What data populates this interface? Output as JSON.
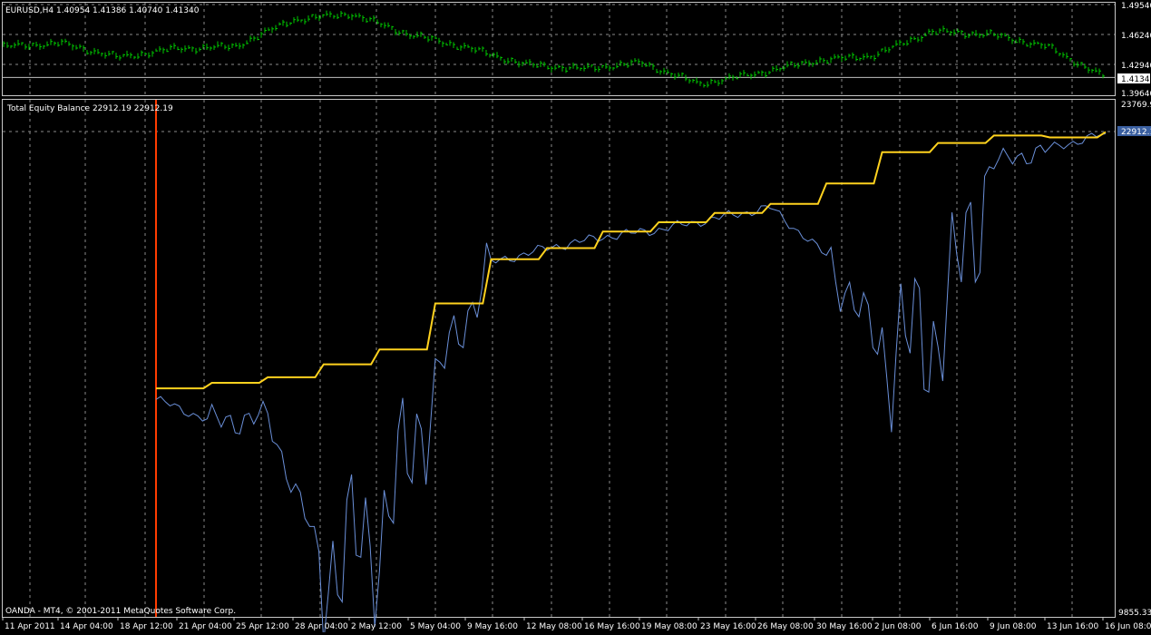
{
  "price_panel": {
    "header": "EURUSD,H4  1.40954 1.41386 1.40740 1.41340",
    "current_price": "1.41340",
    "axis_labels": [
      "1.49540",
      "1.46240",
      "1.42940",
      "1.39640"
    ],
    "colors": {
      "bars": "#00c800",
      "current_line": "#c0c0c0"
    },
    "chart_data": {
      "type": "line",
      "title": "EURUSD,H4",
      "ylim": [
        1.3964,
        1.4954
      ],
      "x": [
        "11 Apr 2011",
        "14 Apr 04:00",
        "18 Apr 12:00",
        "21 Apr 04:00",
        "25 Apr 12:00",
        "28 Apr 04:00",
        "2 May 12:00",
        "5 May 04:00",
        "9 May 16:00",
        "12 May 08:00",
        "16 May 16:00",
        "19 May 08:00",
        "23 May 16:00",
        "26 May 08:00",
        "30 May 16:00",
        "2 Jun 08:00",
        "6 Jun 16:00",
        "9 Jun 08:00",
        "13 Jun 16:00",
        "16 Jun 08:00"
      ],
      "series": [
        {
          "values": [
            1.448,
            1.452,
            1.436,
            1.446,
            1.448,
            1.478,
            1.485,
            1.462,
            1.447,
            1.428,
            1.423,
            1.43,
            1.406,
            1.418,
            1.432,
            1.438,
            1.465,
            1.462,
            1.448,
            1.413
          ]
        }
      ]
    }
  },
  "equity_panel": {
    "header": "Total Equity Balance 22912.19 22912.19",
    "axis_top": "23769.9",
    "axis_bottom": "9855.33",
    "current_value": "22912.1",
    "colors": {
      "balance": "#ffd21e",
      "equity": "#6a8fd8",
      "marker": "#ff3c00",
      "value_box": "#3a5fa0"
    },
    "chart_data": {
      "type": "line",
      "title": "Total Equity Balance",
      "ylim": [
        9855.33,
        23769.9
      ],
      "x": [
        "18 Apr 12:00",
        "21 Apr 04:00",
        "25 Apr 12:00",
        "28 Apr 04:00",
        "2 May 12:00",
        "5 May 04:00",
        "9 May 16:00",
        "12 May 08:00",
        "16 May 16:00",
        "19 May 08:00",
        "23 May 16:00",
        "26 May 08:00",
        "30 May 16:00",
        "2 Jun 08:00",
        "6 Jun 16:00",
        "9 Jun 08:00",
        "13 Jun 16:00",
        "16 Jun 08:00"
      ],
      "series": [
        {
          "values": [
            16000,
            16150,
            16300,
            16650,
            17050,
            18300,
            19500,
            19800,
            20250,
            20500,
            20750,
            21000,
            21550,
            22400,
            22650,
            22850,
            22800,
            22950
          ]
        },
        {
          "values": [
            15700,
            15100,
            15200,
            11200,
            12000,
            16200,
            19400,
            19800,
            20100,
            20300,
            20600,
            20900,
            19600,
            17000,
            17500,
            22100,
            22500,
            22900
          ]
        }
      ]
    }
  },
  "copyright": "OANDA - MT4, © 2001-2011 MetaQuotes Software Corp.",
  "time_axis": [
    "11 Apr 2011",
    "14 Apr 04:00",
    "18 Apr 12:00",
    "21 Apr 04:00",
    "25 Apr 12:00",
    "28 Apr 04:00",
    "2 May 12:00",
    "5 May 04:00",
    "9 May 16:00",
    "12 May 08:00",
    "16 May 16:00",
    "19 May 08:00",
    "23 May 16:00",
    "26 May 08:00",
    "30 May 16:00",
    "2 Jun 08:00",
    "6 Jun 16:00",
    "9 Jun 08:00",
    "13 Jun 16:00",
    "16 Jun 08:00"
  ]
}
